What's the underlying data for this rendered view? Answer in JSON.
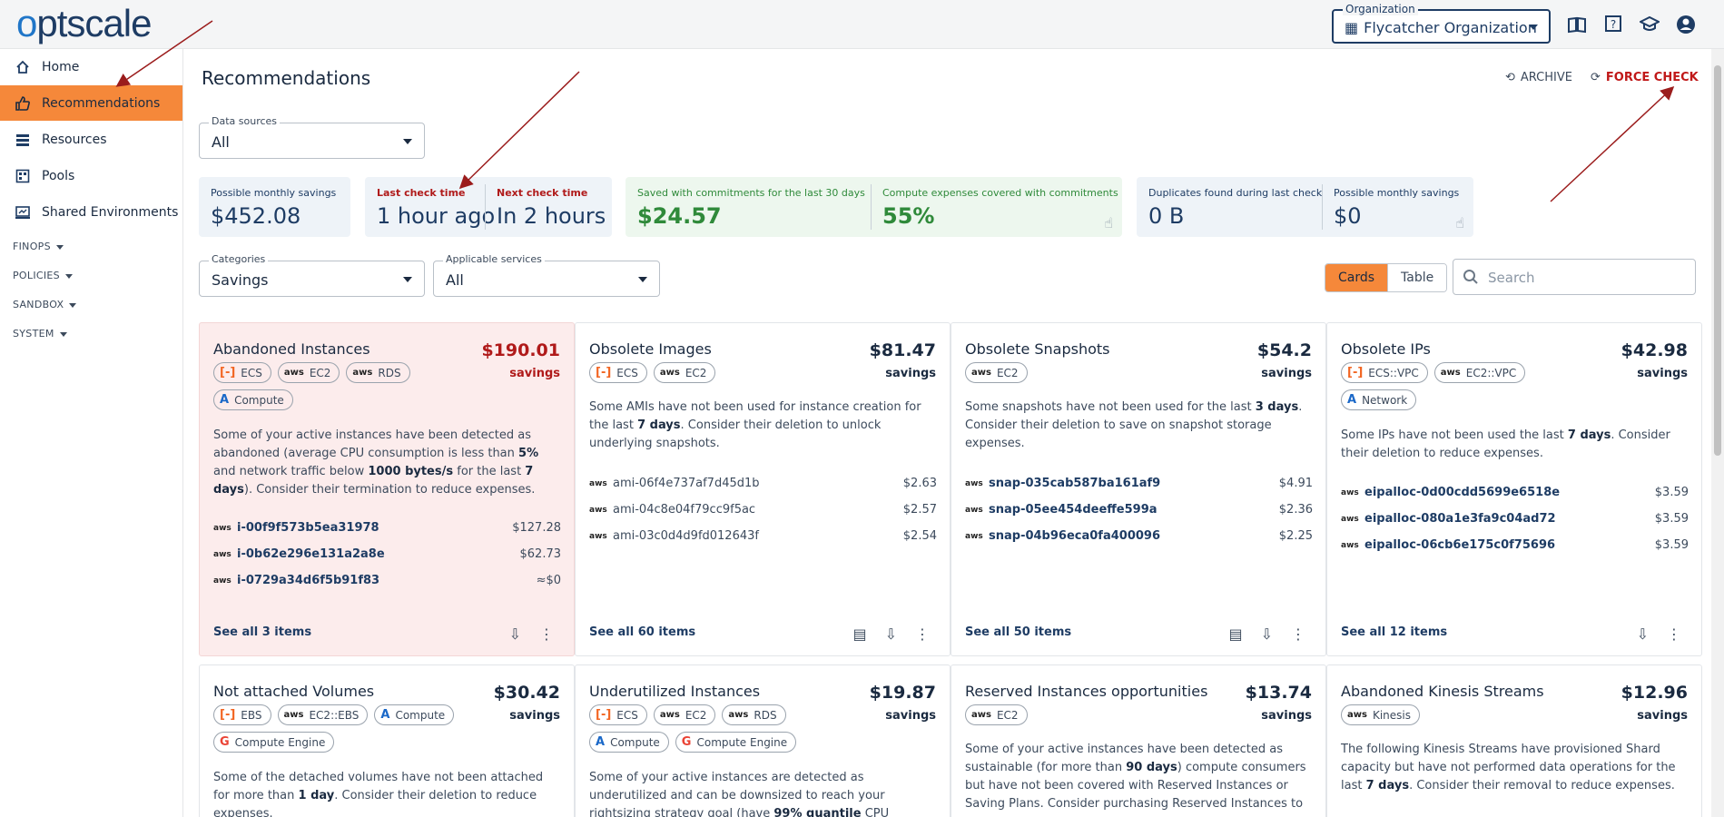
{
  "app": {
    "logo_prefix": "o",
    "logo_rest": "ptscale"
  },
  "header": {
    "org_legend": "Organization",
    "org_name": "Flycatcher Organization"
  },
  "sidebar": {
    "items": [
      {
        "label": "Home",
        "icon": "home-icon"
      },
      {
        "label": "Recommendations",
        "icon": "thumbs-up-icon",
        "active": true
      },
      {
        "label": "Resources",
        "icon": "list-icon"
      },
      {
        "label": "Pools",
        "icon": "pools-icon"
      },
      {
        "label": "Shared Environments",
        "icon": "shared-env-icon"
      }
    ],
    "groups": [
      "FINOPS",
      "POLICIES",
      "SANDBOX",
      "SYSTEM"
    ]
  },
  "page": {
    "title": "Recommendations",
    "archive_label": "ARCHIVE",
    "force_check_label": "FORCE CHECK"
  },
  "filters": {
    "data_sources_label": "Data sources",
    "data_sources_value": "All",
    "categories_label": "Categories",
    "categories_value": "Savings",
    "services_label": "Applicable services",
    "services_value": "All"
  },
  "kpis": {
    "possible_savings_label": "Possible monthly savings",
    "possible_savings_value": "$452.08",
    "last_check_label": "Last check time",
    "last_check_value": "1 hour ago",
    "next_check_label": "Next check time",
    "next_check_value": "In 2 hours",
    "commit_saved_label": "Saved with commitments for the last 30 days",
    "commit_saved_value": "$24.57",
    "commit_covered_label": "Compute expenses covered with commitments",
    "commit_covered_value": "55%",
    "dup_label": "Duplicates found during last check",
    "dup_value": "0 B",
    "dup_savings_label": "Possible monthly savings",
    "dup_savings_value": "$0"
  },
  "view": {
    "cards_label": "Cards",
    "table_label": "Table",
    "search_placeholder": "Search"
  },
  "cards": [
    {
      "title": "Abandoned Instances",
      "price": "$190.01",
      "savings_label": "savings",
      "chips": [
        "ECS",
        "EC2",
        "RDS",
        "Compute"
      ],
      "desc": [
        "Some of your active instances have been detected as abandoned (average CPU consumption is less than ",
        "5%",
        " and network traffic below ",
        "1000 bytes/s",
        " for the last ",
        "7 days",
        "). Consider their termination to reduce expenses."
      ],
      "items": [
        {
          "name": "i-00f9f573b5ea31978",
          "price": "$127.28"
        },
        {
          "name": "i-0b62e296e131a2a8e",
          "price": "$62.73"
        },
        {
          "name": "i-0729a34d6f5b91f83",
          "price": "≈$0"
        }
      ],
      "footer": "See all 3 items"
    },
    {
      "title": "Obsolete Images",
      "price": "$81.47",
      "savings_label": "savings",
      "chips": [
        "ECS",
        "EC2"
      ],
      "desc": [
        "Some AMIs have not been used for instance creation for the last ",
        "7 days",
        ". Consider their deletion to unlock underlying snapshots."
      ],
      "items": [
        {
          "name": "ami-06f4e737af7d45d1b",
          "price": "$2.63"
        },
        {
          "name": "ami-04c8e04f79cc9f5ac",
          "price": "$2.57"
        },
        {
          "name": "ami-03c0d4d9fd012643f",
          "price": "$2.54"
        }
      ],
      "footer": "See all 60 items"
    },
    {
      "title": "Obsolete Snapshots",
      "price": "$54.2",
      "savings_label": "savings",
      "chips": [
        "EC2"
      ],
      "desc": [
        "Some snapshots have not been used for the last ",
        "3 days",
        ". Consider their deletion to save on snapshot storage expenses."
      ],
      "items": [
        {
          "name": "snap-035cab587ba161af9",
          "price": "$4.91"
        },
        {
          "name": "snap-05ee454deeffe599a",
          "price": "$2.36"
        },
        {
          "name": "snap-04b96eca0fa400096",
          "price": "$2.25"
        }
      ],
      "footer": "See all 50 items"
    },
    {
      "title": "Obsolete IPs",
      "price": "$42.98",
      "savings_label": "savings",
      "chips": [
        "ECS::VPC",
        "EC2::VPC",
        "Network"
      ],
      "desc": [
        "Some IPs have not been used the last ",
        "7 days",
        ". Consider their deletion to reduce expenses."
      ],
      "items": [
        {
          "name": "eipalloc-0d00cdd5699e6518e",
          "price": "$3.59"
        },
        {
          "name": "eipalloc-080a1e3fa9c04ad72",
          "price": "$3.59"
        },
        {
          "name": "eipalloc-06cb6e175c0f75696",
          "price": "$3.59"
        }
      ],
      "footer": "See all 12 items"
    },
    {
      "title": "Not attached Volumes",
      "price": "$30.42",
      "savings_label": "savings",
      "chips": [
        "EBS",
        "EC2::EBS",
        "Compute",
        "Compute Engine"
      ],
      "desc": [
        "Some of the detached volumes have not been attached for more than ",
        "1 day",
        ". Consider their deletion to reduce expenses."
      ]
    },
    {
      "title": "Underutilized Instances",
      "price": "$19.87",
      "savings_label": "savings",
      "chips": [
        "ECS",
        "EC2",
        "RDS",
        "Compute",
        "Compute Engine"
      ],
      "desc": [
        "Some of your active instances are detected as underutilized and can be downsized to reach your rightsizing strategy goal (have ",
        "99% quantile",
        " CPU"
      ]
    },
    {
      "title": "Reserved Instances opportunities",
      "price": "$13.74",
      "savings_label": "savings",
      "chips": [
        "EC2"
      ],
      "desc": [
        "Some of your active instances have been detected as sustainable (for more than ",
        "90 days",
        ") compute consumers but have not been covered with Reserved Instances or Saving Plans. Consider purchasing Reserved Instances to"
      ]
    },
    {
      "title": "Abandoned Kinesis Streams",
      "price": "$12.96",
      "savings_label": "savings",
      "chips": [
        "Kinesis"
      ],
      "desc": [
        "The following Kinesis Streams have provisioned Shard capacity but have not performed data operations for the last ",
        "7 days",
        ". Consider their removal to reduce expenses."
      ]
    }
  ],
  "colors": {
    "accent": "#f5883a",
    "brand": "#1e3c64",
    "alert": "#b01a1a",
    "green": "#2f8a3a"
  }
}
